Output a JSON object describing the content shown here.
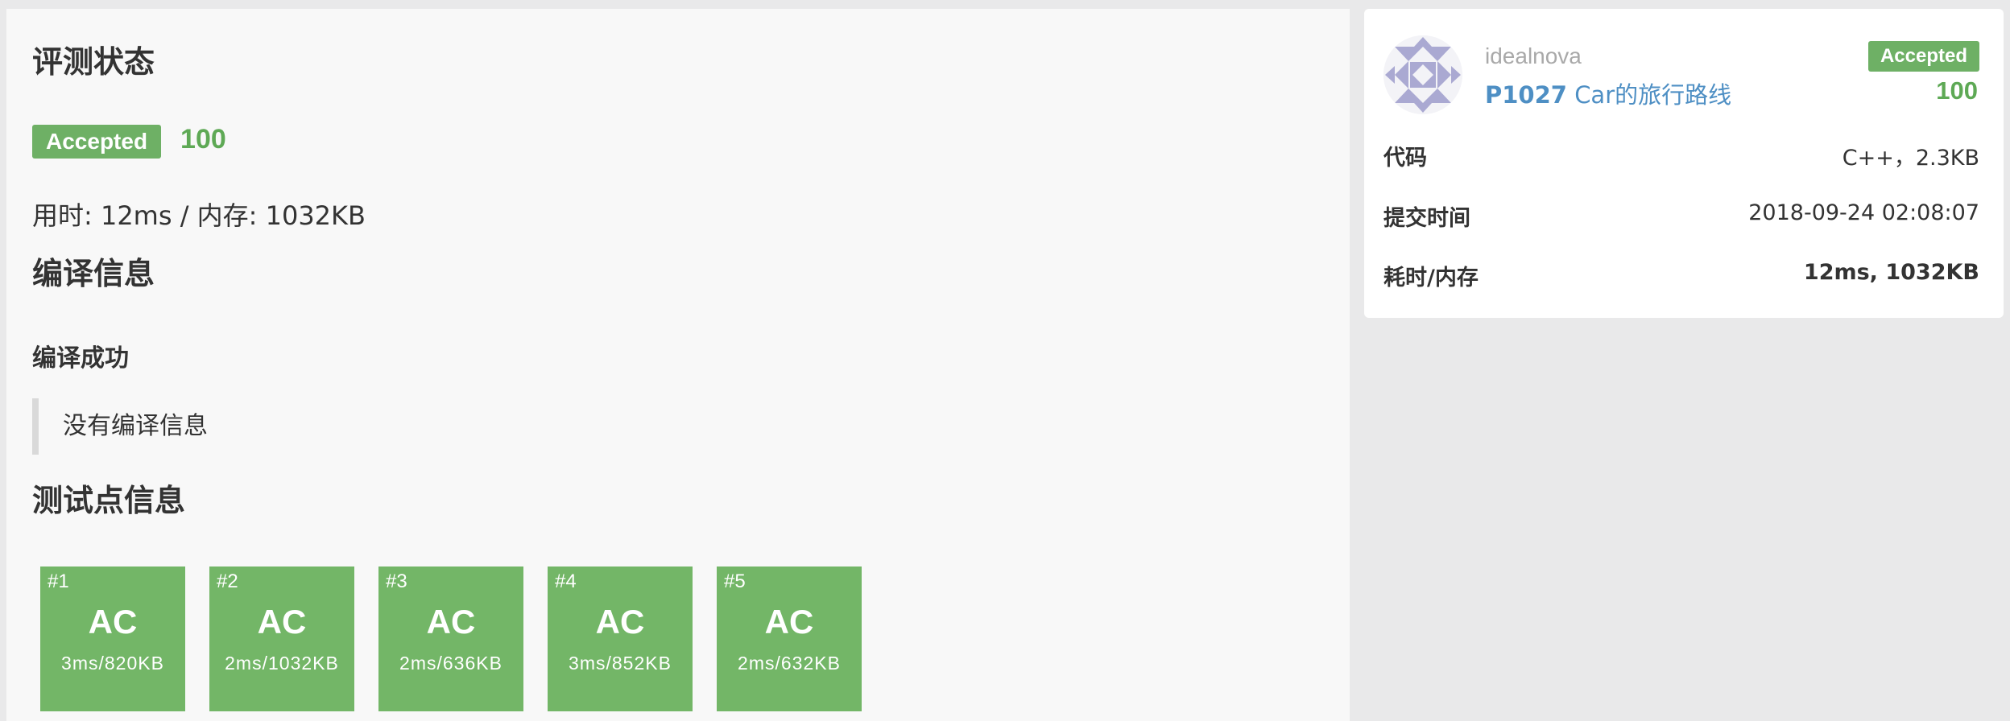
{
  "main": {
    "status_heading": "评测状态",
    "status_badge": "Accepted",
    "score": "100",
    "resource_usage": "用时: 12ms / 内存: 1032KB",
    "compile_heading": "编译信息",
    "compile_result": "编译成功",
    "compile_message": "没有编译信息",
    "tests_heading": "测试点信息",
    "tests": [
      {
        "id": "#1",
        "status": "AC",
        "result": "3ms/820KB"
      },
      {
        "id": "#2",
        "status": "AC",
        "result": "2ms/1032KB"
      },
      {
        "id": "#3",
        "status": "AC",
        "result": "2ms/636KB"
      },
      {
        "id": "#4",
        "status": "AC",
        "result": "3ms/852KB"
      },
      {
        "id": "#5",
        "status": "AC",
        "result": "2ms/632KB"
      }
    ],
    "test_color": "#73b667"
  },
  "sidebar": {
    "avatar_icon": "identicon-avatar",
    "username": "idealnova",
    "problem_id": "P1027",
    "problem_title": "Car的旅行路线",
    "status_badge": "Accepted",
    "score": "100",
    "code_label": "代码",
    "code_value": "C++，2.3KB",
    "submit_time_label": "提交时间",
    "submit_time_value": "2018-09-24 02:08:07",
    "resource_label": "耗时/内存",
    "resource_value": "12ms, 1032KB"
  },
  "colors": {
    "accepted": "#6eb065",
    "link": "#4e8fc4",
    "score": "#5ea955"
  }
}
